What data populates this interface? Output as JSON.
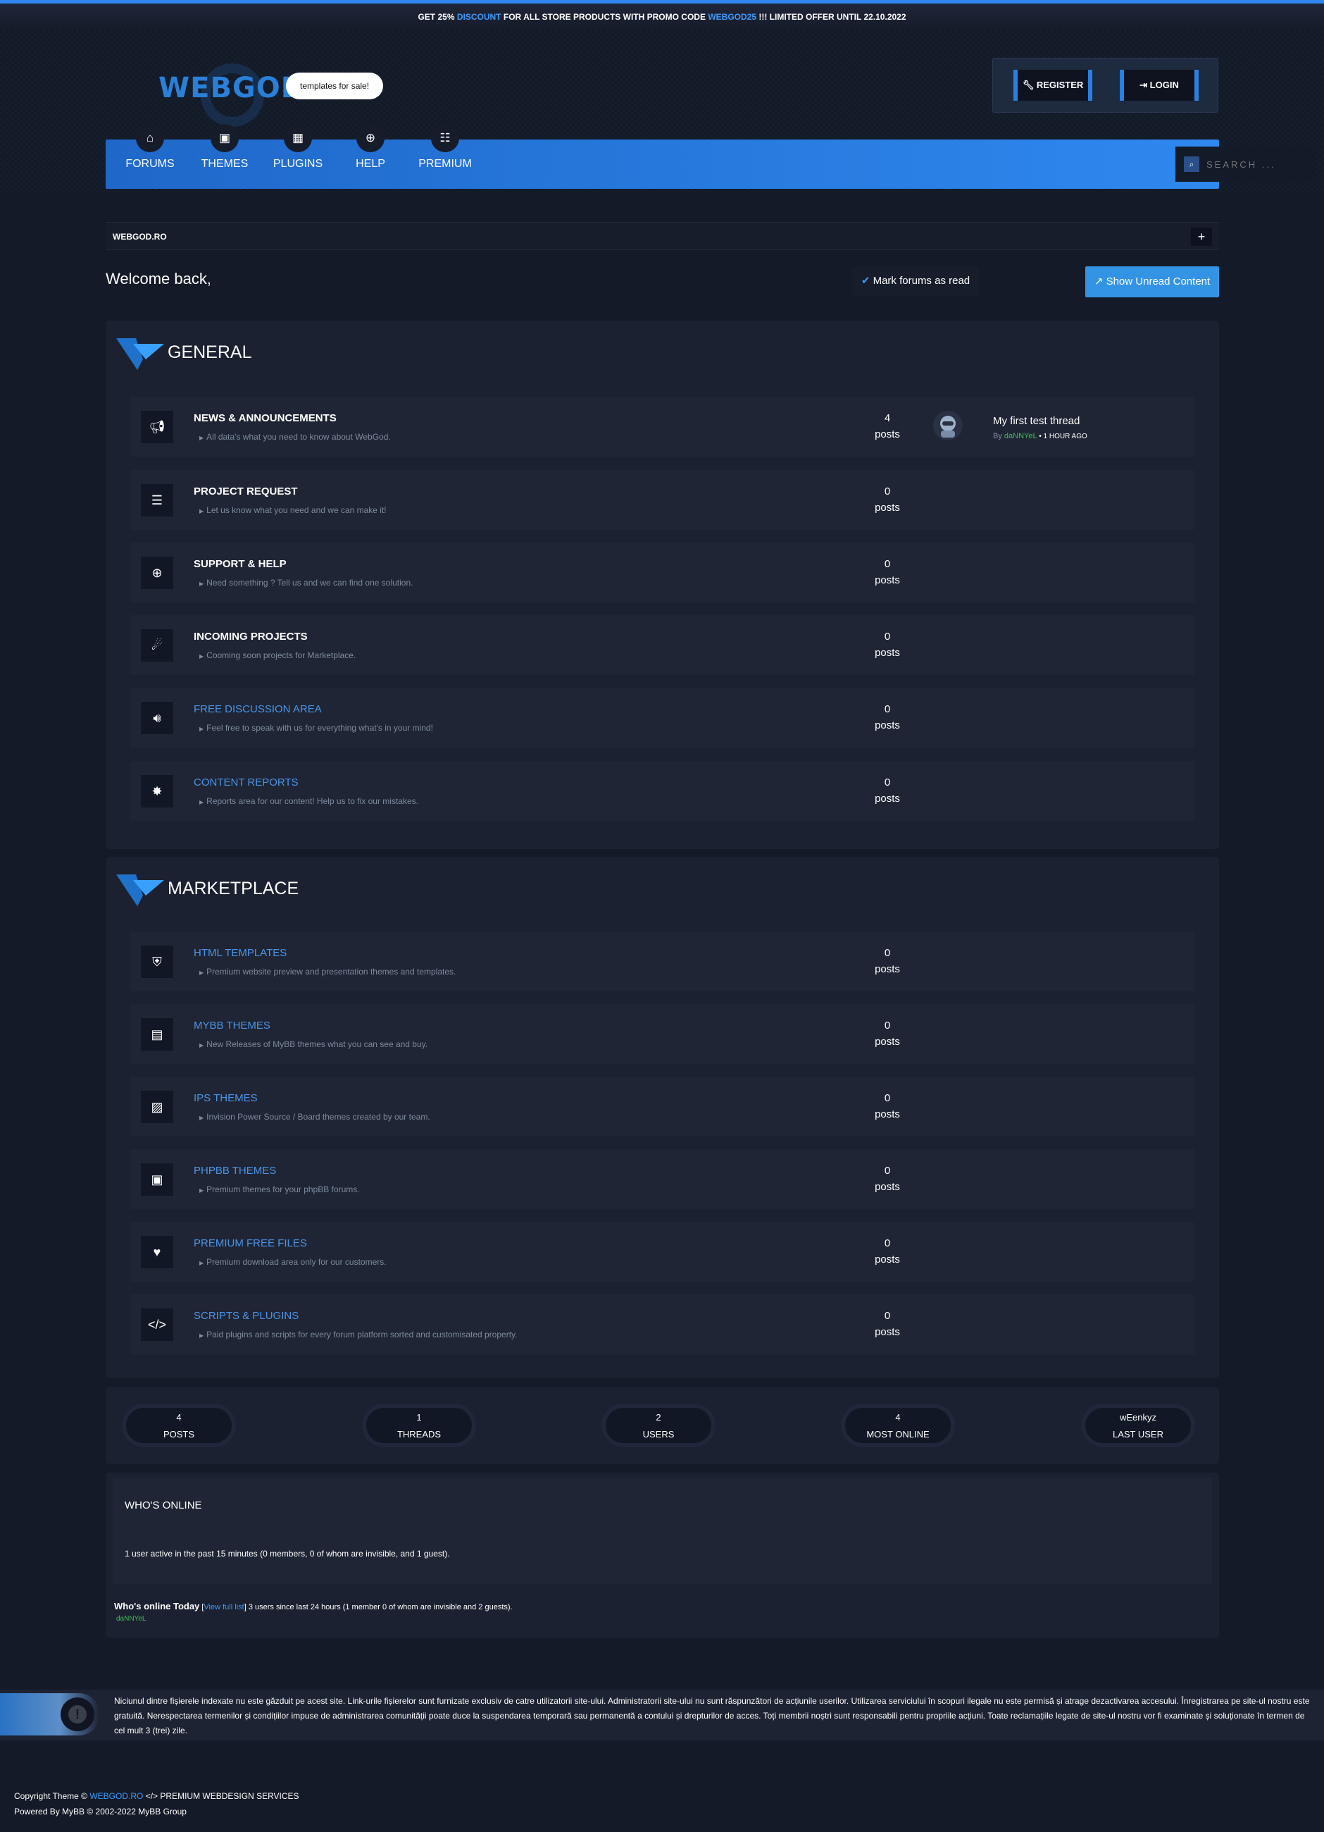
{
  "promo": {
    "part1": "GET 25%",
    "highlight1": "DISCOUNT",
    "part2": "FOR ALL STORE PRODUCTS WITH PROMO CODE",
    "highlight2": "WEBGOD25",
    "part3": "!!! LIMITED OFFER UNTIL 22.10.2022"
  },
  "logo": {
    "text": "WEBGOD",
    "bubble": "templates for sale!"
  },
  "auth": {
    "register": "REGISTER",
    "login": "LOGIN"
  },
  "nav": {
    "items": [
      {
        "label": "FORUMS",
        "icon": "home-icon"
      },
      {
        "label": "THEMES",
        "icon": "images-icon"
      },
      {
        "label": "PLUGINS",
        "icon": "grid-icon"
      },
      {
        "label": "HELP",
        "icon": "lifebuoy-icon"
      },
      {
        "label": "PREMIUM",
        "icon": "sitemap-icon"
      }
    ],
    "search_placeholder": "SEARCH ..."
  },
  "breadcrumb": {
    "text": "WEBGOD.RO",
    "toggle": "+"
  },
  "welcome": "Welcome back,",
  "actions": {
    "mark_read": "Mark forums as read",
    "show_unread": "Show Unread Content"
  },
  "categories": [
    {
      "title": "GENERAL",
      "forums": [
        {
          "title": "NEWS & ANNOUNCEMENTS",
          "desc": "All data's what you need to know about WebGod.",
          "count": "4",
          "unit": "posts",
          "icon": "megaphone-icon",
          "last_post": {
            "title": "My first test thread",
            "by": "By",
            "user": "daNNYeL",
            "time": "1 HOUR AGO"
          }
        },
        {
          "title": "PROJECT REQUEST",
          "desc": "Let us know what you need and we can make it!",
          "count": "0",
          "unit": "posts",
          "icon": "list-check-icon"
        },
        {
          "title": "SUPPORT & HELP",
          "desc": "Need something ? Tell us and we can find one solution.",
          "count": "0",
          "unit": "posts",
          "icon": "lifebuoy-icon"
        },
        {
          "title": "INCOMING PROJECTS",
          "desc": "Cooming soon projects for Marketplace.",
          "count": "0",
          "unit": "posts",
          "icon": "meteor-icon"
        },
        {
          "title": "FREE DISCUSSION AREA",
          "desc": "Feel free to speak with us for everything what's in your mind!",
          "count": "0",
          "unit": "posts",
          "icon": "volume-icon"
        },
        {
          "title": "CONTENT REPORTS",
          "desc": "Reports area for our content! Help us to fix our mistakes.",
          "count": "0",
          "unit": "posts",
          "icon": "bug-icon"
        }
      ]
    },
    {
      "title": "MARKETPLACE",
      "forums": [
        {
          "title": "HTML TEMPLATES",
          "desc": "Premium website preview and presentation themes and templates.",
          "count": "0",
          "unit": "posts",
          "icon": "html5-icon"
        },
        {
          "title": "MYBB THEMES",
          "desc": "New Releases of MyBB themes what you can see and buy.",
          "count": "0",
          "unit": "posts",
          "icon": "box-icon"
        },
        {
          "title": "IPS THEMES",
          "desc": "Invision Power Source / Board themes created by our team.",
          "count": "0",
          "unit": "posts",
          "icon": "file-image-icon"
        },
        {
          "title": "PHPBB THEMES",
          "desc": "Premium themes for your phpBB forums.",
          "count": "0",
          "unit": "posts",
          "icon": "window-icon"
        },
        {
          "title": "PREMIUM FREE FILES",
          "desc": "Premium download area only for our customers.",
          "count": "0",
          "unit": "posts",
          "icon": "heart-icon"
        },
        {
          "title": "SCRIPTS & PLUGINS",
          "desc": "Paid plugins and scripts for every forum platform sorted and customisated property.",
          "count": "0",
          "unit": "posts",
          "icon": "code-icon"
        }
      ]
    }
  ],
  "stats": [
    {
      "value": "4",
      "label": "POSTS"
    },
    {
      "value": "1",
      "label": "THREADS"
    },
    {
      "value": "2",
      "label": "USERS"
    },
    {
      "value": "4",
      "label": "MOST ONLINE"
    },
    {
      "value": "wEenkyz",
      "label": "LAST USER"
    }
  ],
  "online": {
    "title": "WHO'S ONLINE",
    "text": "1 user active in the past 15 minutes (0 members, 0 of whom are invisible, and 1 guest).",
    "today_label": "Who's online Today",
    "view_full": "View full list",
    "today_text": "3 users since last 24 hours (1 member 0 of whom are invisible and 2 guests).",
    "today_user": "daNNYeL"
  },
  "disclaimer": "Niciunul dintre fișierele indexate nu este găzduit pe acest site. Link-urile fișierelor sunt furnizate exclusiv de catre utilizatorii site-ului. Administratorii site-ului nu sunt răspunzători de acțiunile userilor. Utilizarea serviciului în scopuri ilegale nu este permisă și atrage dezactivarea accesului. Înregistrarea pe site-ul nostru este gratuită. Nerespectarea termenilor și condițiilor impuse de administrarea comunității poate duce la suspendarea temporară sau permanentă a contului și drepturilor de acces. Toți membrii noștri sunt responsabili pentru propriile acțiuni. Toate reclamațiile legate de site-ul nostru vor fi examinate și soluționate în termen de cel mult 3 (trei) zile.",
  "footer": {
    "copyright": "Copyright Theme ©",
    "site": "WEBGOD.RO",
    "services": "PREMIUM WEBDESIGN SERVICES",
    "powered": "Powered By MyBB © 2002-2022 MyBB Group"
  },
  "colors": {
    "accent": "#2f86f0",
    "background": "#141a27",
    "panel": "#1b2130",
    "online_user": "#3cbf52"
  }
}
